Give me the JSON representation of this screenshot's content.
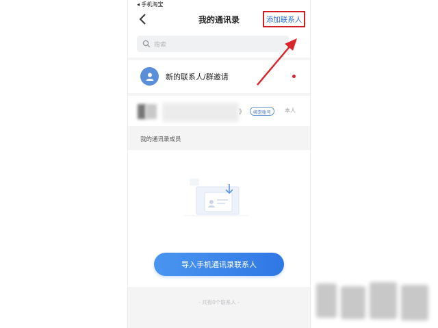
{
  "status_bar": {
    "carrier": "◂ 手机淘宝"
  },
  "nav": {
    "title": "我的通讯录",
    "add_contact_label": "添加联系人"
  },
  "search": {
    "placeholder": "搜索"
  },
  "new_contacts": {
    "label": "新的联系人/群邀请"
  },
  "self_row": {
    "name_tail": "》",
    "badge": "绑定账号",
    "tag": "本人"
  },
  "section": {
    "label": "我的通讯录成员"
  },
  "import_button": {
    "label": "导入手机通讯录联系人"
  },
  "footer": {
    "count_text": "- 共有0个联系人 -"
  },
  "colors": {
    "accent_blue": "#2f77e4",
    "highlight_red": "#d11e25",
    "notify_dot": "#e0202a"
  },
  "icons": [
    "back-icon",
    "search-icon",
    "contact-avatar-icon",
    "empty-contacts-illustration",
    "annotation-arrow"
  ]
}
